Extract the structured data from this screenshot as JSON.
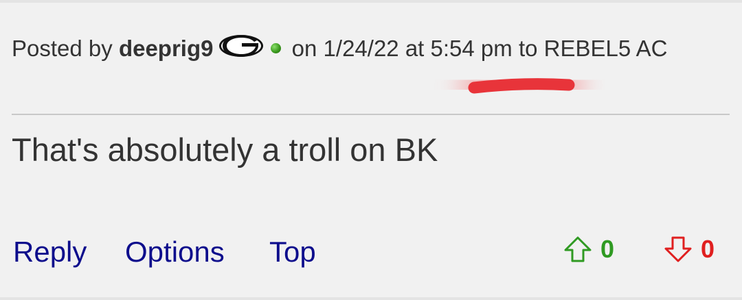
{
  "post": {
    "posted_by_prefix": "Posted by",
    "username": "deeprig9",
    "team_logo_icon": "georgia-g-logo-icon",
    "online_status_icon": "green-dot-icon",
    "on_text": "on",
    "date": "1/24/22",
    "at_text": "at",
    "time": "5:54 pm",
    "to_text": "to",
    "recipient": "REBEL5 AC",
    "body": "That's absolutely a troll on BK"
  },
  "actions": {
    "reply": "Reply",
    "options": "Options",
    "top": "Top"
  },
  "votes": {
    "up_count": "0",
    "down_count": "0",
    "up_icon": "arrow-up-icon",
    "down_icon": "arrow-down-icon",
    "up_color": "#2f9a22",
    "down_color": "#e01f1f"
  },
  "colors": {
    "link": "#0d0d8c",
    "text": "#333333",
    "background": "#f1f1f1",
    "annotation": "#e8343a"
  }
}
